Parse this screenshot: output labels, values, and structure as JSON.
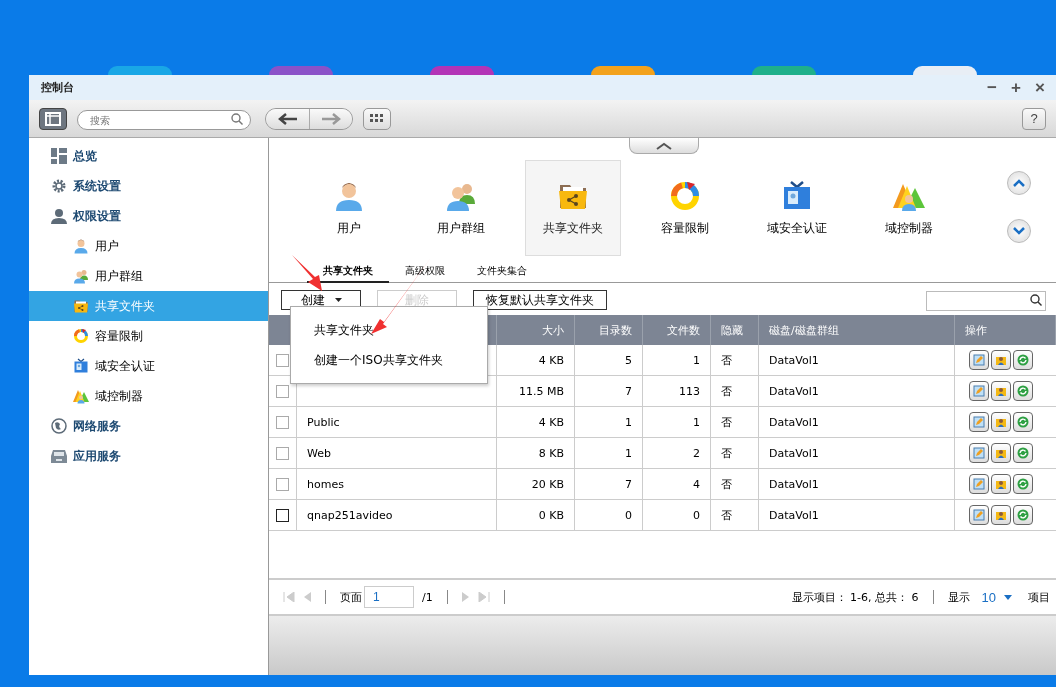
{
  "window": {
    "title": "控制台",
    "buttons": [
      "−",
      "+",
      "×"
    ]
  },
  "toolbar": {
    "search": {
      "placeholder": "搜索"
    },
    "help": "?"
  },
  "sidebar": {
    "items": [
      {
        "label": "总览",
        "selected": false
      },
      {
        "label": "系统设置",
        "selected": false
      },
      {
        "label": "权限设置",
        "selected": false,
        "children": [
          {
            "label": "用户",
            "selected": false
          },
          {
            "label": "用户群组",
            "selected": false
          },
          {
            "label": "共享文件夹",
            "selected": true
          },
          {
            "label": "容量限制",
            "selected": false
          },
          {
            "label": "域安全认证",
            "selected": false
          },
          {
            "label": "域控制器",
            "selected": false
          }
        ]
      },
      {
        "label": "网络服务",
        "selected": false
      },
      {
        "label": "应用服务",
        "selected": false
      }
    ]
  },
  "modules": [
    {
      "label": "用户",
      "selected": false
    },
    {
      "label": "用户群组",
      "selected": false
    },
    {
      "label": "共享文件夹",
      "selected": true
    },
    {
      "label": "容量限制",
      "selected": false
    },
    {
      "label": "域安全认证",
      "selected": false
    },
    {
      "label": "域控制器",
      "selected": false
    }
  ],
  "tabs": [
    {
      "label": "共享文件夹",
      "selected": true
    },
    {
      "label": "高级权限",
      "selected": false
    },
    {
      "label": "文件夹集合",
      "selected": false
    }
  ],
  "actions": [
    {
      "label": "创建",
      "kind": "dropdown",
      "disabled": false
    },
    {
      "label": "删除",
      "kind": "button",
      "disabled": true
    },
    {
      "label": "恢复默认共享文件夹",
      "kind": "button",
      "disabled": false
    }
  ],
  "create_menu": [
    "共享文件夹",
    "创建一个ISO共享文件夹"
  ],
  "table": {
    "columns": [
      "大小",
      "目录数",
      "文件数",
      "隐藏",
      "磁盘/磁盘群组",
      "操作"
    ],
    "rows": [
      {
        "checked": false,
        "size": "4 KB",
        "dirs": "5",
        "files": "1",
        "hidden": "否",
        "volume": "DataVol1"
      },
      {
        "checked": false,
        "size": "11.5 MB",
        "dirs": "7",
        "files": "113",
        "hidden": "否",
        "volume": "DataVol1"
      },
      {
        "checked": false,
        "name": "Public",
        "size": "4 KB",
        "dirs": "1",
        "files": "1",
        "hidden": "否",
        "volume": "DataVol1"
      },
      {
        "checked": false,
        "name": "Web",
        "size": "8 KB",
        "dirs": "1",
        "files": "2",
        "hidden": "否",
        "volume": "DataVol1"
      },
      {
        "checked": false,
        "name": "homes",
        "size": "20 KB",
        "dirs": "7",
        "files": "4",
        "hidden": "否",
        "volume": "DataVol1"
      },
      {
        "checked": false,
        "name": "qnap251avideo",
        "size": "0 KB",
        "dirs": "0",
        "files": "0",
        "hidden": "否",
        "volume": "DataVol1"
      }
    ]
  },
  "pager": {
    "page_label": "页面",
    "page": "1",
    "total": "/1",
    "summary": "显示项目： 1-6, 总共： 6",
    "show_label": "显示",
    "per_page": "10",
    "items_label": "项目"
  }
}
